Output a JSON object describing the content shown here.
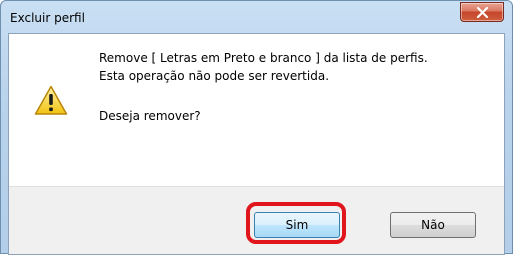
{
  "dialog": {
    "title": "Excluir perfil",
    "message_line1": "Remove [ Letras em Preto e branco ] da lista de perfis.",
    "message_line2": "Esta operação não pode ser revertida.",
    "question": "Deseja remover?",
    "icon": "warning-icon"
  },
  "buttons": {
    "yes_label": "Sim",
    "no_label": "Não",
    "close_icon": "close-icon"
  },
  "colors": {
    "highlight": "#e0161c",
    "close_button": "#c5452a",
    "titlebar": "#b9d3ec"
  }
}
